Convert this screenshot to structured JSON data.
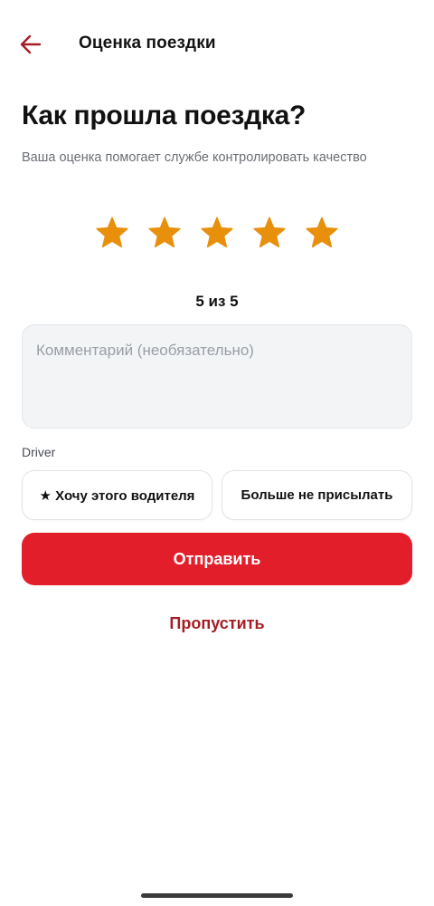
{
  "topbar": {
    "back_icon": "arrow-left-icon",
    "title": "Оценка поездки"
  },
  "main": {
    "headline": "Как прошла поездка?",
    "subtitle": "Ваша оценка помогает службе контролировать качество"
  },
  "rating": {
    "value": 5,
    "max": 5,
    "label": "5 из 5",
    "icon": "star-icon",
    "filled_color": "#e8900c"
  },
  "comment": {
    "placeholder": "Комментарий (необязательно)",
    "value": ""
  },
  "driver_section": {
    "label": "Driver",
    "options": [
      {
        "label": "★ Хочу этого водителя"
      },
      {
        "label": "Больше не присылать"
      }
    ]
  },
  "actions": {
    "submit_label": "Отправить",
    "skip_label": "Пропустить"
  },
  "colors": {
    "accent": "#e31e2b",
    "accent_dark": "#a61e25",
    "star": "#e8900c"
  }
}
